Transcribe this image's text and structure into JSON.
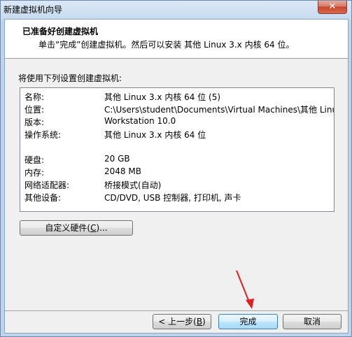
{
  "window": {
    "title": "新建虚拟机向导",
    "close_glyph": "✕"
  },
  "header": {
    "title": "已准备好创建虚拟机",
    "subtitle": "单击“完成”创建虚拟机。然后可以安装 其他 Linux 3.x 内核 64 位。"
  },
  "intro": "将使用下列设置创建虚拟机:",
  "summary": [
    {
      "key": "名称:",
      "value": "其他 Linux 3.x 内核 64 位 (5)"
    },
    {
      "key": "位置:",
      "value": "C:\\Users\\student\\Documents\\Virtual Machines\\其他 Linux ..."
    },
    {
      "key": "版本:",
      "value": "Workstation 10.0"
    },
    {
      "key": "操作系统:",
      "value": "其他 Linux 3.x 内核 64 位"
    },
    {
      "key": "硬盘:",
      "value": "20 GB"
    },
    {
      "key": "内存:",
      "value": "2048 MB"
    },
    {
      "key": "网络适配器:",
      "value": "桥接模式(自动)"
    },
    {
      "key": "其他设备:",
      "value": "CD/DVD, USB 控制器, 打印机, 声卡"
    }
  ],
  "buttons": {
    "customize": {
      "pre": "自定义硬件(",
      "key": "C",
      "post": ")..."
    },
    "back": {
      "pre": "< 上一步(",
      "key": "B",
      "post": ")"
    },
    "finish": "完成",
    "cancel": "取消"
  },
  "annotation": {
    "color": "#e02020"
  }
}
